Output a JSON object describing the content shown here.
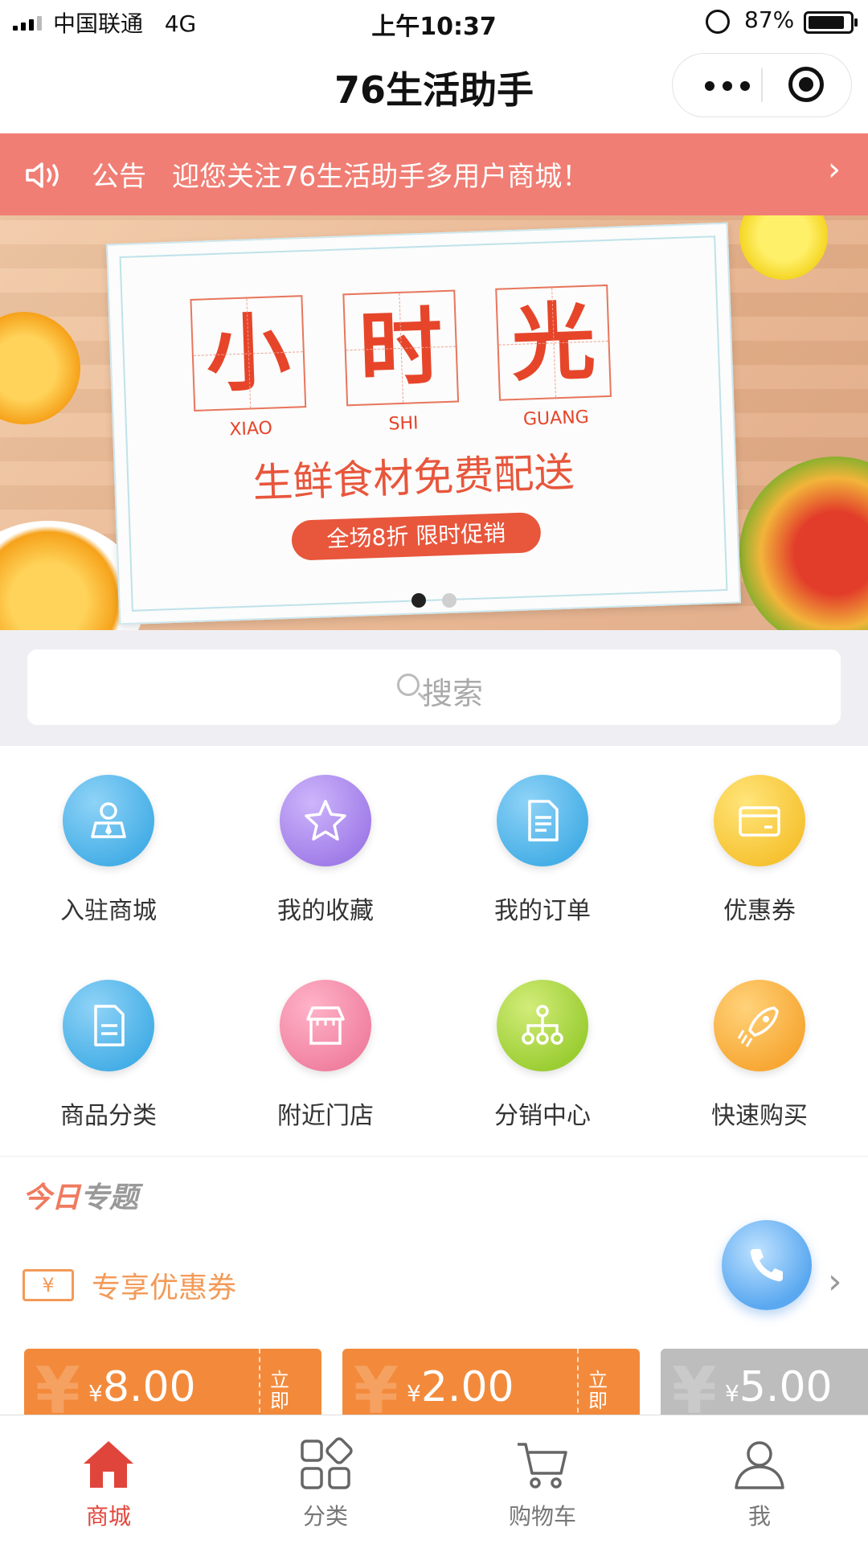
{
  "status_bar": {
    "carrier": "中国联通",
    "network": "4G",
    "time": "上午10:37",
    "battery": "87%"
  },
  "navbar": {
    "title": "76生活助手"
  },
  "notice": {
    "label": "公告",
    "text": "迎您关注76生活助手多用户商城！"
  },
  "banner": {
    "chars": [
      "小",
      "时",
      "光"
    ],
    "pinyin": [
      "XIAO",
      "SHI",
      "GUANG"
    ],
    "slogan": "生鲜食材免费配送",
    "promo": "全场8折 限时促销",
    "slides": 2,
    "active_slide": 1
  },
  "search": {
    "placeholder": "搜索"
  },
  "menu": [
    {
      "label": "入驻商城",
      "icon": "merchant-icon",
      "color": "#45aee6"
    },
    {
      "label": "我的收藏",
      "icon": "star-icon",
      "color": "#a07ce8"
    },
    {
      "label": "我的订单",
      "icon": "order-icon",
      "color": "#45aee6"
    },
    {
      "label": "优惠券",
      "icon": "coupon-card-icon",
      "color": "#f6c231"
    },
    {
      "label": "商品分类",
      "icon": "category-doc-icon",
      "color": "#45aee6"
    },
    {
      "label": "附近门店",
      "icon": "store-icon",
      "color": "#f080a0"
    },
    {
      "label": "分销中心",
      "icon": "network-icon",
      "color": "#9acd32"
    },
    {
      "label": "快速购买",
      "icon": "rocket-icon",
      "color": "#f7a733"
    }
  ],
  "topic": {
    "title_a": "今日",
    "title_b": "专题",
    "coupon_icon": "¥",
    "coupon_label": "专享优惠券"
  },
  "coupons": [
    {
      "currency": "¥",
      "amount": "8.00",
      "action": "立即",
      "color": "#f38a3b"
    },
    {
      "currency": "¥",
      "amount": "2.00",
      "action": "立即",
      "color": "#f38a3b"
    },
    {
      "currency": "¥",
      "amount": "5.00",
      "action": "",
      "color": "#bdbdbd"
    }
  ],
  "tabs": [
    {
      "label": "商城",
      "icon": "home-icon",
      "active": true
    },
    {
      "label": "分类",
      "icon": "grid-icon",
      "active": false
    },
    {
      "label": "购物车",
      "icon": "cart-icon",
      "active": false
    },
    {
      "label": "我",
      "icon": "user-icon",
      "active": false
    }
  ],
  "colors": {
    "accent": "#e0453b",
    "notice_bg": "#f07e74",
    "coupon_orange": "#f38a3b"
  }
}
